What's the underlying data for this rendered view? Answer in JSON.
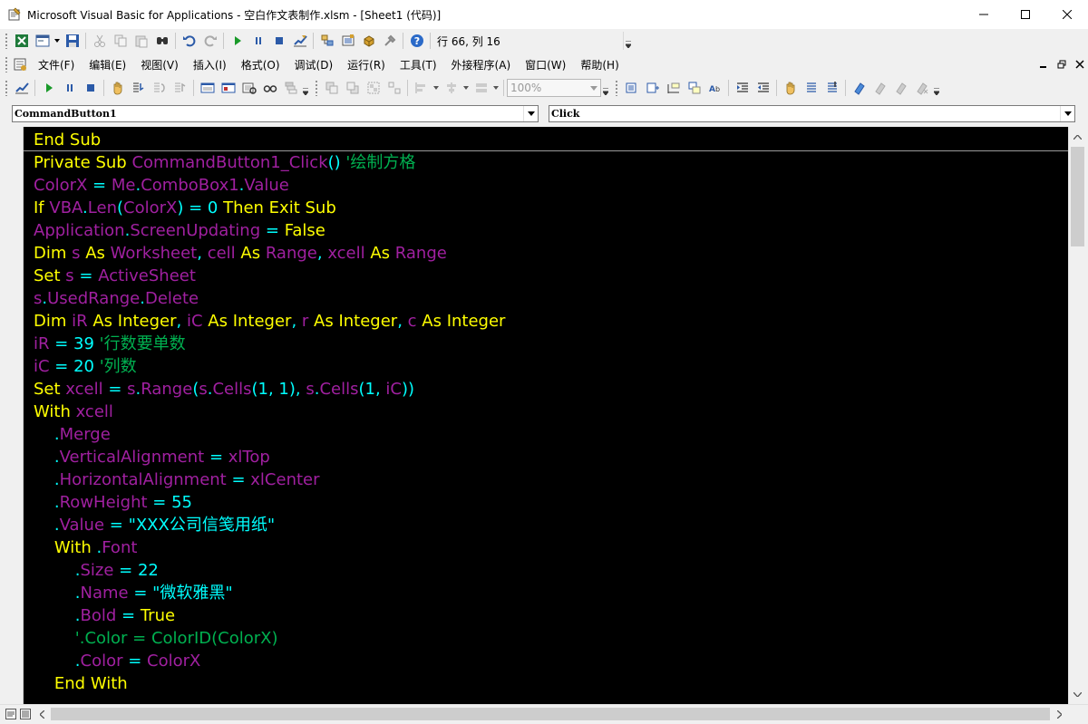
{
  "window": {
    "title": "Microsoft Visual Basic for Applications - 空白作文表制作.xlsm - [Sheet1 (代码)]"
  },
  "standard_toolbar": {
    "position_text": "行 66, 列 16",
    "buttons": [
      "view-excel-icon",
      "insert-userform-icon",
      "save-icon",
      "cut-icon",
      "copy-icon",
      "paste-icon",
      "find-icon",
      "undo-icon",
      "redo-icon",
      "run-icon",
      "break-icon",
      "reset-icon",
      "design-mode-icon",
      "project-explorer-icon",
      "properties-icon",
      "object-browser-icon",
      "toolbox-icon",
      "help-icon"
    ]
  },
  "menu": {
    "items": [
      "文件(F)",
      "编辑(E)",
      "视图(V)",
      "插入(I)",
      "格式(O)",
      "调试(D)",
      "运行(R)",
      "工具(T)",
      "外接程序(A)",
      "窗口(W)",
      "帮助(H)"
    ]
  },
  "debug_toolbar": {
    "zoom_value": "100%"
  },
  "object_combo": {
    "value": "CommandButton1"
  },
  "procedure_combo": {
    "value": "Click"
  },
  "code": {
    "lines": [
      [
        [
          "k",
          "End Sub"
        ]
      ],
      [
        [
          "k",
          "Private Sub "
        ],
        [
          "v",
          "CommandButton1_Click"
        ],
        [
          "o",
          "() "
        ],
        [
          "c",
          "'绘制方格"
        ]
      ],
      [
        [
          "v",
          "ColorX"
        ],
        [
          "o",
          " = "
        ],
        [
          "v",
          "Me"
        ],
        [
          "o",
          "."
        ],
        [
          "v",
          "ComboBox1"
        ],
        [
          "o",
          "."
        ],
        [
          "v",
          "Value"
        ]
      ],
      [
        [
          "k",
          "If "
        ],
        [
          "v",
          "VBA"
        ],
        [
          "o",
          "."
        ],
        [
          "v",
          "Len"
        ],
        [
          "o",
          "("
        ],
        [
          "v",
          "ColorX"
        ],
        [
          "o",
          ") = 0 "
        ],
        [
          "k",
          "Then Exit Sub"
        ]
      ],
      [
        [
          "v",
          "Application"
        ],
        [
          "o",
          "."
        ],
        [
          "v",
          "ScreenUpdating"
        ],
        [
          "o",
          " = "
        ],
        [
          "k",
          "False"
        ]
      ],
      [
        [
          "k",
          "Dim "
        ],
        [
          "v",
          "s"
        ],
        [
          "k",
          " As "
        ],
        [
          "v",
          "Worksheet"
        ],
        [
          "o",
          ", "
        ],
        [
          "v",
          "cell"
        ],
        [
          "k",
          " As "
        ],
        [
          "v",
          "Range"
        ],
        [
          "o",
          ", "
        ],
        [
          "v",
          "xcell"
        ],
        [
          "k",
          " As "
        ],
        [
          "v",
          "Range"
        ]
      ],
      [
        [
          "k",
          "Set "
        ],
        [
          "v",
          "s"
        ],
        [
          "o",
          " = "
        ],
        [
          "v",
          "ActiveSheet"
        ]
      ],
      [
        [
          "v",
          "s"
        ],
        [
          "o",
          "."
        ],
        [
          "v",
          "UsedRange"
        ],
        [
          "o",
          "."
        ],
        [
          "v",
          "Delete"
        ]
      ],
      [
        [
          "k",
          "Dim "
        ],
        [
          "v",
          "iR"
        ],
        [
          "k",
          " As Integer"
        ],
        [
          "o",
          ", "
        ],
        [
          "v",
          "iC"
        ],
        [
          "k",
          " As Integer"
        ],
        [
          "o",
          ", "
        ],
        [
          "v",
          "r"
        ],
        [
          "k",
          " As Integer"
        ],
        [
          "o",
          ", "
        ],
        [
          "v",
          "c"
        ],
        [
          "k",
          " As Integer"
        ]
      ],
      [
        [
          "v",
          "iR"
        ],
        [
          "o",
          " = 39 "
        ],
        [
          "c",
          "'行数要单数"
        ]
      ],
      [
        [
          "v",
          "iC"
        ],
        [
          "o",
          " = 20 "
        ],
        [
          "c",
          "'列数"
        ]
      ],
      [
        [
          "k",
          "Set "
        ],
        [
          "v",
          "xcell"
        ],
        [
          "o",
          " = "
        ],
        [
          "v",
          "s"
        ],
        [
          "o",
          "."
        ],
        [
          "v",
          "Range"
        ],
        [
          "o",
          "("
        ],
        [
          "v",
          "s"
        ],
        [
          "o",
          "."
        ],
        [
          "v",
          "Cells"
        ],
        [
          "o",
          "(1, 1), "
        ],
        [
          "v",
          "s"
        ],
        [
          "o",
          "."
        ],
        [
          "v",
          "Cells"
        ],
        [
          "o",
          "(1, "
        ],
        [
          "v",
          "iC"
        ],
        [
          "o",
          "))"
        ]
      ],
      [
        [
          "k",
          "With "
        ],
        [
          "v",
          "xcell"
        ]
      ],
      [
        [
          "o",
          "    ."
        ],
        [
          "v",
          "Merge"
        ]
      ],
      [
        [
          "o",
          "    ."
        ],
        [
          "v",
          "VerticalAlignment"
        ],
        [
          "o",
          " = "
        ],
        [
          "v",
          "xlTop"
        ]
      ],
      [
        [
          "o",
          "    ."
        ],
        [
          "v",
          "HorizontalAlignment"
        ],
        [
          "o",
          " = "
        ],
        [
          "v",
          "xlCenter"
        ]
      ],
      [
        [
          "o",
          "    ."
        ],
        [
          "v",
          "RowHeight"
        ],
        [
          "o",
          " = 55"
        ]
      ],
      [
        [
          "o",
          "    ."
        ],
        [
          "v",
          "Value"
        ],
        [
          "o",
          " = \"XXX公司信笺用纸\""
        ]
      ],
      [
        [
          "k",
          "    With "
        ],
        [
          "o",
          "."
        ],
        [
          "v",
          "Font"
        ]
      ],
      [
        [
          "o",
          "        ."
        ],
        [
          "v",
          "Size"
        ],
        [
          "o",
          " = 22"
        ]
      ],
      [
        [
          "o",
          "        ."
        ],
        [
          "v",
          "Name"
        ],
        [
          "o",
          " = \"微软雅黑\""
        ]
      ],
      [
        [
          "o",
          "        ."
        ],
        [
          "v",
          "Bold"
        ],
        [
          "o",
          " = "
        ],
        [
          "k",
          "True"
        ]
      ],
      [
        [
          "c",
          "        '.Color = ColorID(ColorX)"
        ]
      ],
      [
        [
          "o",
          "        ."
        ],
        [
          "v",
          "Color"
        ],
        [
          "o",
          " = "
        ],
        [
          "v",
          "ColorX"
        ]
      ],
      [
        [
          "k",
          "    End With"
        ]
      ]
    ]
  }
}
